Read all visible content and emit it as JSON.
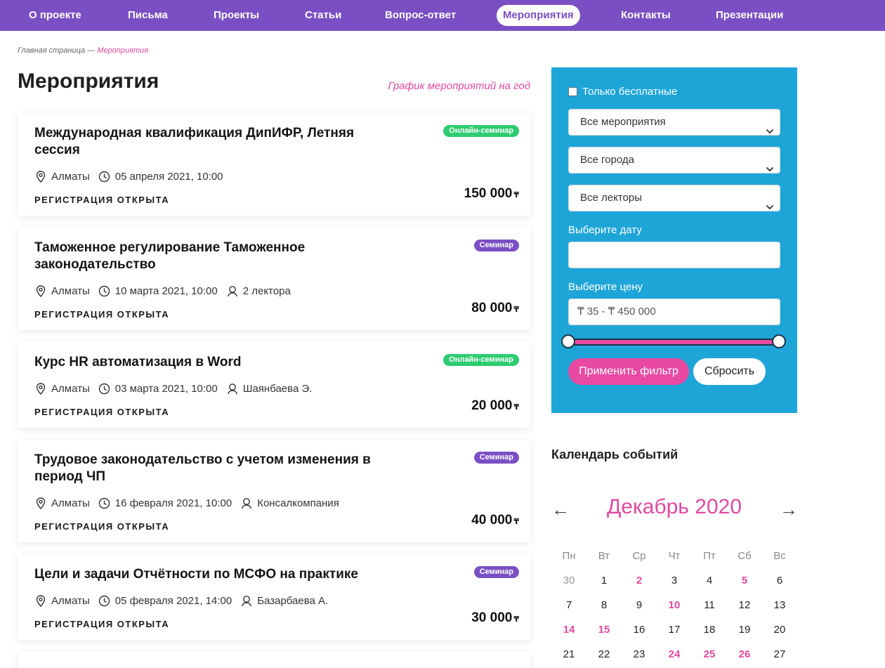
{
  "nav": [
    {
      "label": "О проекте",
      "active": false
    },
    {
      "label": "Письма",
      "active": false
    },
    {
      "label": "Проекты",
      "active": false
    },
    {
      "label": "Статьи",
      "active": false
    },
    {
      "label": "Вопрос-ответ",
      "active": false
    },
    {
      "label": "Мероприятия",
      "active": true
    },
    {
      "label": "Контакты",
      "active": false
    },
    {
      "label": "Презентации",
      "active": false
    }
  ],
  "breadcrumb": {
    "home": "Главная страница",
    "separator": "—",
    "current": "Мероприятия"
  },
  "page": {
    "title": "Мероприятия",
    "schedule_link": "График мероприятий на год"
  },
  "colors": {
    "nav": "#7b4fc4",
    "accent": "#e04aa0",
    "filter_bg": "#1ea5d8",
    "online_badge": "#2ecc71",
    "seminar_badge": "#7b4fc4"
  },
  "events": [
    {
      "title": "Международная квалификация ДипИФР, Летняя сессия",
      "badge": "Онлайн-семинар",
      "badge_type": "online",
      "city": "Алматы",
      "date": "05 апреля 2021, 10:00",
      "lecturer": "",
      "status": "РЕГИСТРАЦИЯ ОТКРЫТА",
      "price": "150 000",
      "currency": "₸"
    },
    {
      "title": "Таможенное регулирование Таможенное законодательство",
      "badge": "Семинар",
      "badge_type": "seminar",
      "city": "Алматы",
      "date": "10 марта 2021, 10:00",
      "lecturer": "2 лектора",
      "status": "РЕГИСТРАЦИЯ ОТКРЫТА",
      "price": "80 000",
      "currency": "₸"
    },
    {
      "title": "Курс HR автоматизация в Word",
      "badge": "Онлайн-семинар",
      "badge_type": "online",
      "city": "Алматы",
      "date": "03 марта 2021, 10:00",
      "lecturer": "Шаянбаева Э.",
      "status": "РЕГИСТРАЦИЯ ОТКРЫТА",
      "price": "20 000",
      "currency": "₸"
    },
    {
      "title": "Трудовое законодательство с учетом изменения в период ЧП",
      "badge": "Семинар",
      "badge_type": "seminar",
      "city": "Алматы",
      "date": "16 февраля 2021, 10:00",
      "lecturer": "Консалкомпания",
      "status": "РЕГИСТРАЦИЯ ОТКРЫТА",
      "price": "40 000",
      "currency": "₸"
    },
    {
      "title": "Цели и задачи Отчётности по МСФО на практике",
      "badge": "Семинар",
      "badge_type": "seminar",
      "city": "Алматы",
      "date": "05 февраля 2021, 14:00",
      "lecturer": "Базарбаева А.",
      "status": "РЕГИСТРАЦИЯ ОТКРЫТА",
      "price": "30 000",
      "currency": "₸"
    }
  ],
  "filter": {
    "free_only_label": "Только бесплатные",
    "free_only_checked": false,
    "event_type": "Все мероприятия",
    "city": "Все города",
    "lecturer": "Все лекторы",
    "date_label": "Выберите дату",
    "date_value": "",
    "price_label": "Выберите цену",
    "price_value": "₸ 35 - ₸ 450 000",
    "price_range": [
      35,
      450000
    ],
    "apply_label": "Применить фильтр",
    "reset_label": "Сбросить"
  },
  "calendar": {
    "title": "Календарь событий",
    "month": "Декабрь 2020",
    "prev": "←",
    "next": "→",
    "weekdays": [
      "Пн",
      "Вт",
      "Ср",
      "Чт",
      "Пт",
      "Сб",
      "Вс"
    ],
    "weeks": [
      [
        {
          "d": "30",
          "other": true
        },
        {
          "d": "1"
        },
        {
          "d": "2",
          "event": true
        },
        {
          "d": "3"
        },
        {
          "d": "4"
        },
        {
          "d": "5",
          "event": true
        },
        {
          "d": "6"
        }
      ],
      [
        {
          "d": "7"
        },
        {
          "d": "8"
        },
        {
          "d": "9"
        },
        {
          "d": "10",
          "event": true
        },
        {
          "d": "11"
        },
        {
          "d": "12"
        },
        {
          "d": "13"
        }
      ],
      [
        {
          "d": "14",
          "event": true
        },
        {
          "d": "15",
          "event": true
        },
        {
          "d": "16"
        },
        {
          "d": "17"
        },
        {
          "d": "18"
        },
        {
          "d": "19"
        },
        {
          "d": "20"
        }
      ],
      [
        {
          "d": "21"
        },
        {
          "d": "22"
        },
        {
          "d": "23"
        },
        {
          "d": "24",
          "event": true
        },
        {
          "d": "25",
          "event": true
        },
        {
          "d": "26",
          "event": true
        },
        {
          "d": "27"
        }
      ]
    ]
  }
}
